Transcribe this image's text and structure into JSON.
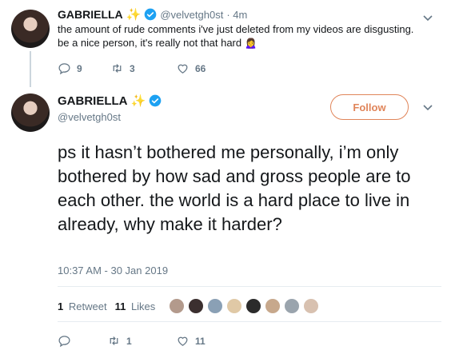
{
  "tweet1": {
    "name": "GABRIELLA",
    "sparkle": "✨",
    "handle": "@velvetgh0st",
    "time": "· 4m",
    "text": "the amount of rude comments i've just deleted from my videos are disgusting. be a nice person, it's really not that hard",
    "emoji": "🙍‍♀️",
    "replies": "9",
    "retweets": "3",
    "likes": "66"
  },
  "tweet2": {
    "name": "GABRIELLA",
    "sparkle": "✨",
    "handle": "@velvetgh0st",
    "follow_label": "Follow",
    "text": "ps it hasn’t bothered me personally, i’m only bothered by how sad and gross people are to each other. the world is a hard place to live in already, why make it harder?",
    "timestamp": "10:37 AM - 30 Jan 2019",
    "retweet_count": "1",
    "retweet_label": "Retweet",
    "like_count": "11",
    "like_label": "Likes",
    "action_retweets": "1",
    "action_likes": "11"
  },
  "likers": [
    "#b39a8c",
    "#3b2f2f",
    "#8aa0b5",
    "#e0c9a6",
    "#2b2b2b",
    "#c7a88c",
    "#9aa4ad",
    "#d8c1b0"
  ],
  "colors": {
    "accent": "#e0855a",
    "verified": "#1da1f2",
    "muted": "#657786",
    "text": "#14171a"
  }
}
